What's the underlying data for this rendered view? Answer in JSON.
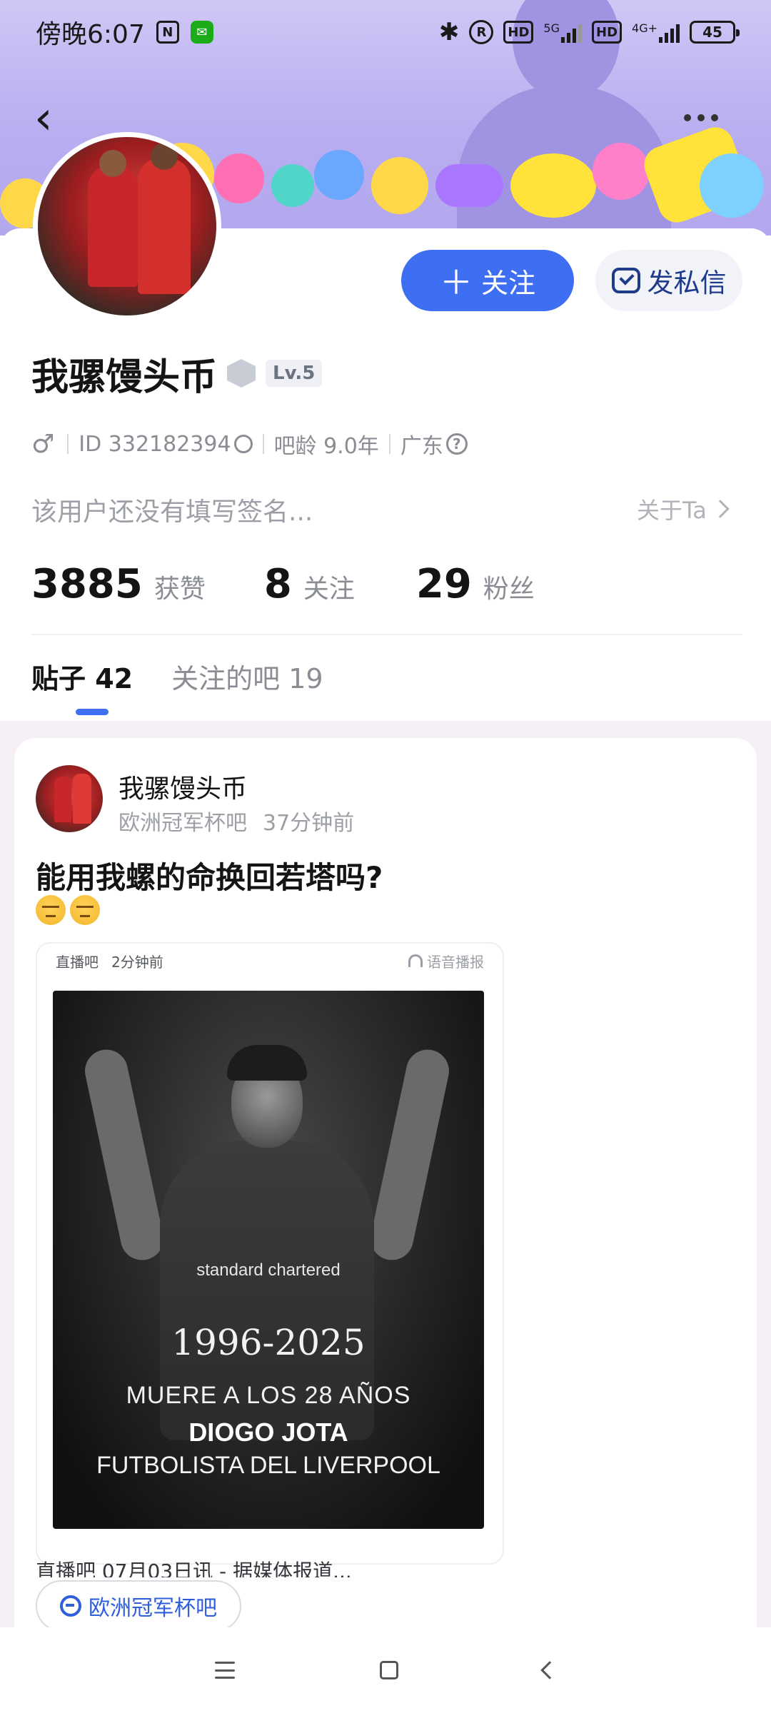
{
  "status_bar": {
    "time": "傍晚6:07",
    "icons": [
      "nfc-icon",
      "wechat-icon",
      "bluetooth-icon",
      "registered-icon",
      "hd-icon",
      "signal-5g-icon",
      "hd-icon",
      "signal-4g-icon"
    ],
    "net1": "5G",
    "net2": "4G+",
    "hd": "HD",
    "battery": "45"
  },
  "header": {
    "back_icon": "chevron-left-icon",
    "more_icon": "more-horizontal-icon"
  },
  "profile": {
    "username": "我骡馒头币",
    "level": "Lv.5",
    "gender_symbol": "♂",
    "id": "ID 332182394",
    "forum_age": "吧龄 9.0年",
    "location": "广东",
    "signature": "该用户还没有填写签名...",
    "about": "关于Ta",
    "follow_button": "关注",
    "follow_plus": "＋",
    "message_button": "发私信",
    "stats": [
      {
        "num": "3885",
        "label": "获赞"
      },
      {
        "num": "8",
        "label": "关注"
      },
      {
        "num": "29",
        "label": "粉丝"
      }
    ]
  },
  "tabs": [
    {
      "label": "贴子 42",
      "active": true
    },
    {
      "label": "关注的吧 19",
      "active": false
    }
  ],
  "post": {
    "author": "我骡馒头币",
    "forum": "欧洲冠军杯吧",
    "time": "37分钟前",
    "title": "能用我螺的命换回若塔吗?",
    "share": {
      "source": "直播吧",
      "time": "2分钟前",
      "audio": "语音播报",
      "poster": {
        "sponsor": "standard chartered",
        "years": "1996-2025",
        "line1": "MUERE A LOS 28 AÑOS",
        "line2": "DIOGO JOTA",
        "line3": "FUTBOLISTA DEL LIVERPOOL"
      },
      "footer": "直播吧 07月03日讯 - 据媒体报道..."
    },
    "forum_tag": "欧洲冠军杯吧"
  },
  "system_nav": {
    "icons": [
      "menu-icon",
      "home-icon",
      "back-icon"
    ]
  }
}
